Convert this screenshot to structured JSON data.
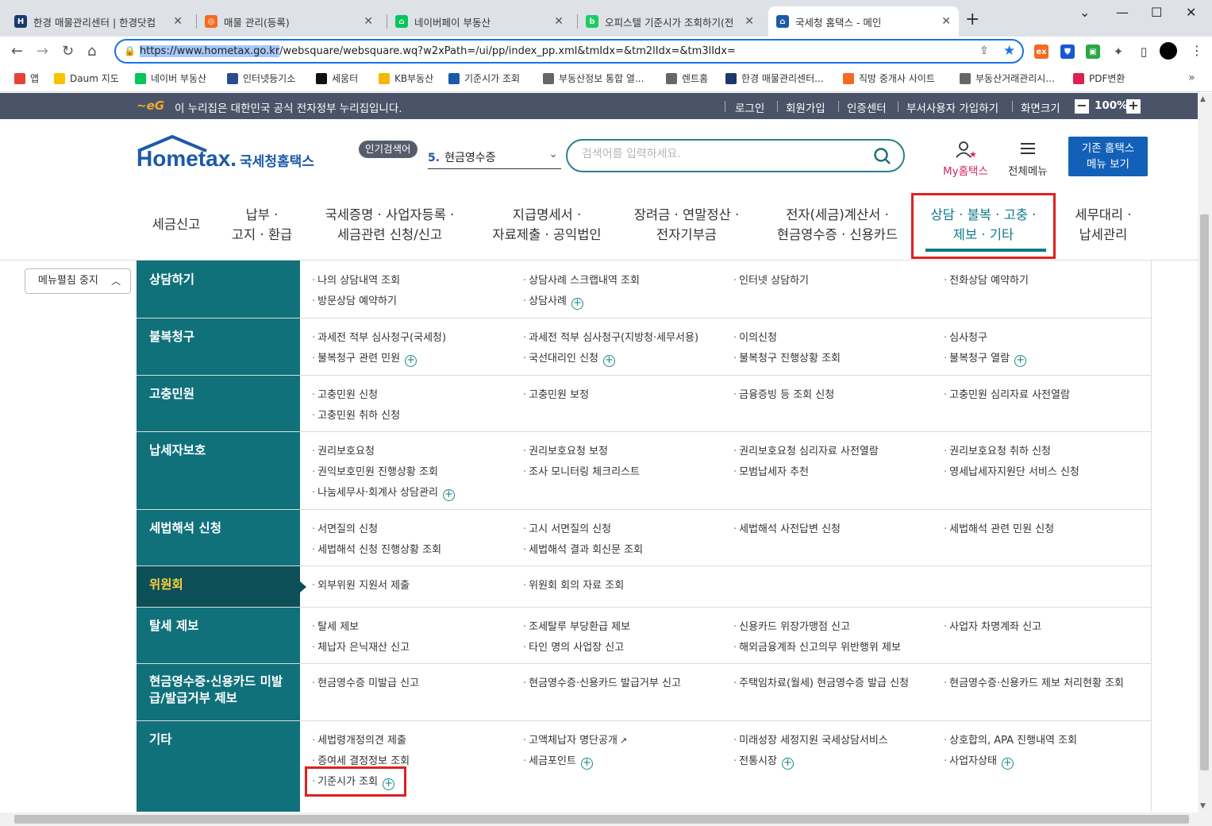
{
  "browser": {
    "tabs": [
      {
        "title": "한경 매물관리센터 | 한경닷컴",
        "color": "#1b3a6b",
        "glyph": "H"
      },
      {
        "title": "매물 관리(등록)",
        "color": "#f26b21",
        "glyph": "◎"
      },
      {
        "title": "네이버페이 부동산",
        "color": "#03c75a",
        "glyph": "⌂"
      },
      {
        "title": "오피스텔 기준시가 조회하기(전",
        "color": "#19ce60",
        "glyph": "b"
      },
      {
        "title": "국세청 홈택스 - 메인",
        "color": "#1b5aa8",
        "glyph": "⌂"
      }
    ],
    "url_host": "https://www.hometax.go.kr",
    "url_path": "/websquare/websquare.wq?w2xPath=/ui/pp/index_pp.xml&tmIdx=&tm2lIdx=&tm3lIdx=",
    "bookmarks": [
      {
        "label": "앱",
        "color": "#e94235"
      },
      {
        "label": "Daum 지도",
        "color": "#f5c400"
      },
      {
        "label": "네이버 부동산",
        "color": "#03c75a"
      },
      {
        "label": "인터넷등기소",
        "color": "#2b4c8c"
      },
      {
        "label": "세움터",
        "color": "#111111"
      },
      {
        "label": "KB부동산",
        "color": "#f5b800"
      },
      {
        "label": "기준시가 조회",
        "color": "#1b5aa8"
      },
      {
        "label": "부동산정보 통합 열...",
        "color": "#666666"
      },
      {
        "label": "렌트홈",
        "color": "#666666"
      },
      {
        "label": "한경 매물관리센터...",
        "color": "#1b3a6b"
      },
      {
        "label": "직방 중개사 사이트",
        "color": "#f26b21"
      },
      {
        "label": "부동산거래관리시...",
        "color": "#666666"
      },
      {
        "label": "PDF변환",
        "color": "#e02050"
      }
    ]
  },
  "govbar": {
    "notice": "이 누리집은 대한민국 공식 전자정부 누리집입니다.",
    "links": [
      "로그인",
      "회원가입",
      "인증센터",
      "부서사용자 가입하기",
      "화면크기"
    ],
    "zoom": "100%"
  },
  "header": {
    "logo_en": "Hometax.",
    "logo_kr": "국세청홈택스",
    "popular_badge": "인기검색어",
    "popular_num": "5.",
    "popular_term": "현금영수증",
    "search_placeholder": "검색어를 입력하세요.",
    "my_home": "My홈택스",
    "all_menu": "전체메뉴",
    "old_btn_l1": "기존 홈택스",
    "old_btn_l2": "메뉴 보기"
  },
  "gnb": [
    {
      "l1": "세금신고",
      "l2": ""
    },
    {
      "l1": "납부 ·",
      "l2": "고지 · 환급"
    },
    {
      "l1": "국세증명 · 사업자등록 ·",
      "l2": "세금관련 신청/신고"
    },
    {
      "l1": "지급명세서 ·",
      "l2": "자료제출 · 공익법인"
    },
    {
      "l1": "장려금 · 연말정산 ·",
      "l2": "전자기부금"
    },
    {
      "l1": "전자(세금)계산서 ·",
      "l2": "현금영수증 · 신용카드"
    },
    {
      "l1": "상담 · 불복 · 고충 ·",
      "l2": "제보 · 기타"
    },
    {
      "l1": "세무대리 ·",
      "l2": "납세관리"
    }
  ],
  "fold_button": "메뉴펼침 중지",
  "categories": [
    {
      "name": "상담하기",
      "items": [
        [
          "나의 상담내역 조회",
          "상담사례 스크랩내역 조회",
          "인터넷 상담하기",
          "전화상담 예약하기"
        ],
        [
          "방문상담 예약하기",
          "상담사례+"
        ]
      ]
    },
    {
      "name": "불복청구",
      "items": [
        [
          "과세전 적부 심사청구(국세청)",
          "과세전 적부 심사청구(지방청·세무서용)",
          "이의신청",
          "심사청구"
        ],
        [
          "불복청구 관련 민원+",
          "국선대리인 신청+",
          "불복청구 진행상황 조회",
          "불복청구 열람+"
        ]
      ]
    },
    {
      "name": "고충민원",
      "items": [
        [
          "고충민원 신청",
          "고충민원 보정",
          "금융증빙 등 조회 신청",
          "고충민원 심리자료 사전열람"
        ],
        [
          "고충민원 취하 신청"
        ]
      ]
    },
    {
      "name": "납세자보호",
      "items": [
        [
          "권리보호요청",
          "권리보호요청 보정",
          "권리보호요청 심리자료 사전열람",
          "권리보호요청 취하 신청"
        ],
        [
          "권익보호민원 진행상황 조회",
          "조사 모니터링 체크리스트",
          "모범납세자 추천",
          "영세납세자지원단 서비스 신청"
        ],
        [
          "나눔세무사·회계사 상담관리+"
        ]
      ]
    },
    {
      "name": "세법해석 신청",
      "items": [
        [
          "서면질의 신청",
          "고시 서면질의 신청",
          "세법해석 사전답변 신청",
          "세법해석 관련 민원 신청"
        ],
        [
          "세법해석 신청 진행상황 조회",
          "세법해석 결과 회신문 조회"
        ]
      ]
    },
    {
      "name": "위원회",
      "items": [
        [
          "외부위원 지원서 제출",
          "위원회 회의 자료 조회"
        ]
      ]
    },
    {
      "name": "탈세 제보",
      "items": [
        [
          "탈세 제보",
          "조세탈루 부당환급 제보",
          "신용카드 위장가맹점 신고",
          "사업자 차명계좌 신고"
        ],
        [
          "체납자 은닉재산 신고",
          "타인 명의 사업장 신고",
          "해외금융계좌 신고의무 위반행위 제보"
        ]
      ]
    },
    {
      "name": "현금영수증·신용카드 미발급/발급거부 제보",
      "items": [
        [
          "현금영수증 미발급 신고",
          "현금영수증·신용카드 발급거부 신고",
          "주택임차료(월세) 현금영수증 발급 신청",
          "현금영수증·신용카드 제보 처리현황 조회"
        ]
      ]
    },
    {
      "name": "기타",
      "items": [
        [
          "세법령개정의견 제출",
          "고액체납자 명단공개^",
          "미래성장 세정지원 국세상담서비스",
          "상호합의, APA 진행내역 조회"
        ],
        [
          "증여세 결정정보 조회",
          "세금포인트+",
          "전통시장+",
          "사업자상태+"
        ],
        [
          "기준시가 조회+"
        ]
      ]
    }
  ]
}
